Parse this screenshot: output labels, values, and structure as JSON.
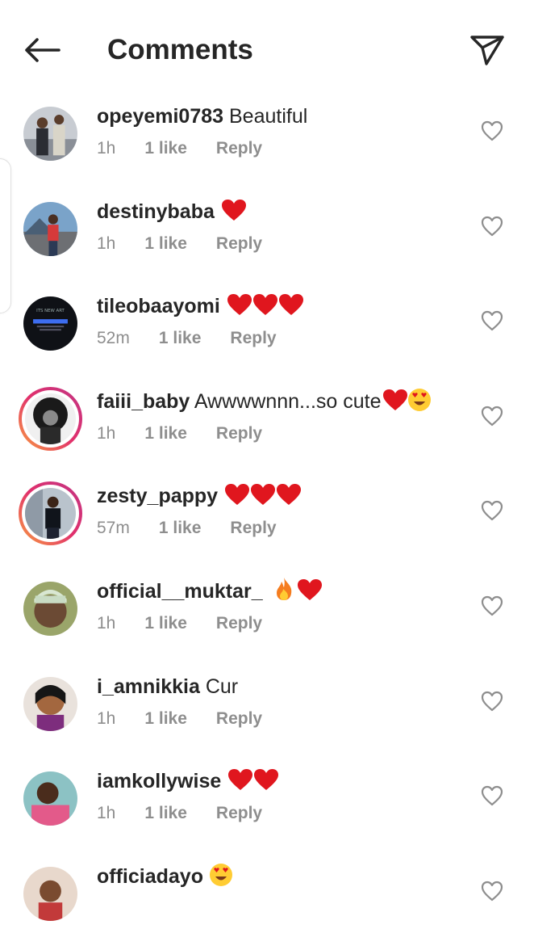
{
  "header": {
    "title": "Comments",
    "back_icon": "arrow-left-icon",
    "share_icon": "paper-plane-icon"
  },
  "colors": {
    "text": "#262626",
    "muted": "#8e8e8e",
    "heart_emoji": "#e0161e",
    "story_ring": "#e1306c"
  },
  "comments": [
    {
      "username": "opeyemi0783",
      "text": "Beautiful",
      "emoji": [],
      "time": "1h",
      "likes": "1 like",
      "reply": "Reply",
      "story": false
    },
    {
      "username": "destinybaba",
      "text": "",
      "emoji": [
        "red-heart"
      ],
      "time": "1h",
      "likes": "1 like",
      "reply": "Reply",
      "story": false
    },
    {
      "username": "tileobaayomi",
      "text": "",
      "emoji": [
        "red-heart",
        "red-heart",
        "red-heart"
      ],
      "time": "52m",
      "likes": "1 like",
      "reply": "Reply",
      "story": false
    },
    {
      "username": "faiii_baby",
      "text": "Awwwwnnn...so cute",
      "emoji": [
        "red-heart",
        "heart-eyes-face"
      ],
      "time": "1h",
      "likes": "1 like",
      "reply": "Reply",
      "story": true
    },
    {
      "username": "zesty_pappy",
      "text": "",
      "emoji": [
        "red-heart",
        "red-heart",
        "red-heart"
      ],
      "time": "57m",
      "likes": "1 like",
      "reply": "Reply",
      "story": true
    },
    {
      "username": "official__muktar_",
      "text": "",
      "emoji": [
        "fire",
        "red-heart"
      ],
      "time": "1h",
      "likes": "1 like",
      "reply": "Reply",
      "story": false
    },
    {
      "username": "i_amnikkia",
      "text": "Cur",
      "emoji": [],
      "time": "1h",
      "likes": "1 like",
      "reply": "Reply",
      "story": false
    },
    {
      "username": "iamkollywise",
      "text": "",
      "emoji": [
        "red-heart",
        "red-heart"
      ],
      "time": "1h",
      "likes": "1 like",
      "reply": "Reply",
      "story": false
    },
    {
      "username": "officiadayo",
      "text": "",
      "emoji": [
        "heart-eyes-face"
      ],
      "time": "",
      "likes": "",
      "reply": "",
      "story": false
    }
  ]
}
